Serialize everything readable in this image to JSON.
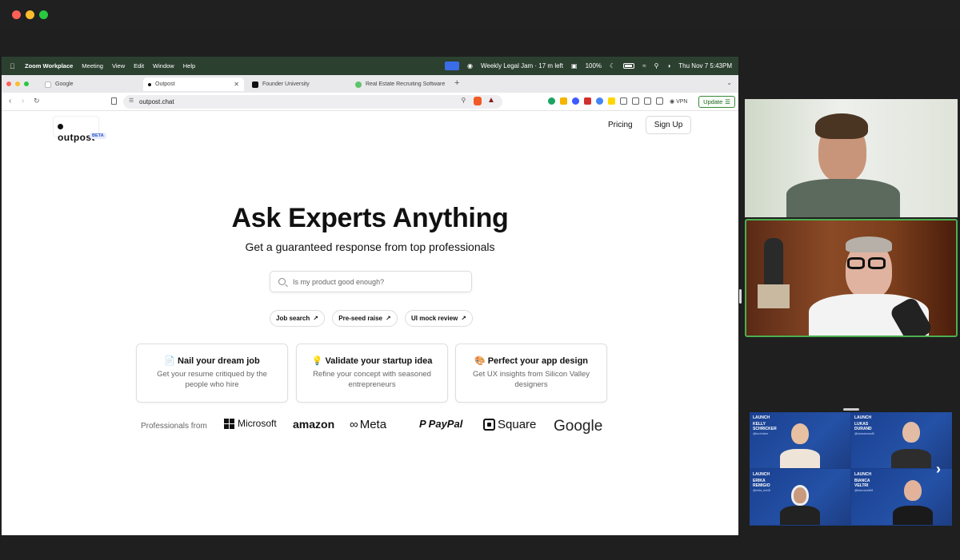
{
  "zoom_menubar": {
    "app": "Zoom Workplace",
    "items": [
      "Meeting",
      "View",
      "Edit",
      "Window",
      "Help"
    ],
    "meeting_status": "Weekly Legal Jam · 17 m left",
    "battery": "100%",
    "datetime": "Thu Nov 7  5:43PM"
  },
  "browser": {
    "tabs": [
      {
        "title": "Google",
        "active": false
      },
      {
        "title": "Outpost",
        "active": true
      },
      {
        "title": "Founder University",
        "active": false
      },
      {
        "title": "Real Estate Recruiting Software",
        "active": false
      }
    ],
    "url": "outpost.chat",
    "vpn_label": "VPN",
    "update_label": "Update"
  },
  "site": {
    "logo": "outpost",
    "beta": "BETA",
    "nav": {
      "pricing": "Pricing",
      "signup": "Sign Up"
    },
    "hero_title": "Ask Experts Anything",
    "hero_subtitle": "Get a guaranteed response from top professionals",
    "search_placeholder": "Is my product good enough?",
    "chips": [
      "Job search",
      "Pre-seed raise",
      "UI mock review"
    ],
    "cards": [
      {
        "icon": "📄",
        "title": "Nail your dream job",
        "desc": "Get your resume critiqued by the people who hire"
      },
      {
        "icon": "💡",
        "title": "Validate your startup idea",
        "desc": "Refine your concept with seasoned entrepreneurs"
      },
      {
        "icon": "🎨",
        "title": "Perfect your app design",
        "desc": "Get UX insights from Silicon Valley designers"
      }
    ],
    "professionals_label": "Professionals from",
    "brands": [
      "Microsoft",
      "amazon",
      "Meta",
      "PayPal",
      "Square",
      "Google"
    ]
  },
  "participants": {
    "grid": [
      {
        "event": "LAUNCH",
        "name": "KELLY\nSCHRICKER",
        "handle": "@kschricker"
      },
      {
        "event": "LAUNCH",
        "name": "LUKAS\nDURAND",
        "handle": "@lukasdurand8"
      },
      {
        "event": "LAUNCH",
        "name": "ERIKA\nREMIGIO",
        "handle": "@erika_remi8"
      },
      {
        "event": "LAUNCH",
        "name": "BIANCA\nVELTRI",
        "handle": "@biancaveltri8"
      }
    ]
  },
  "colors": {
    "accent_green": "#4caf50",
    "menubar": "#2c4030",
    "launch_blue": "#1b3f8a"
  }
}
